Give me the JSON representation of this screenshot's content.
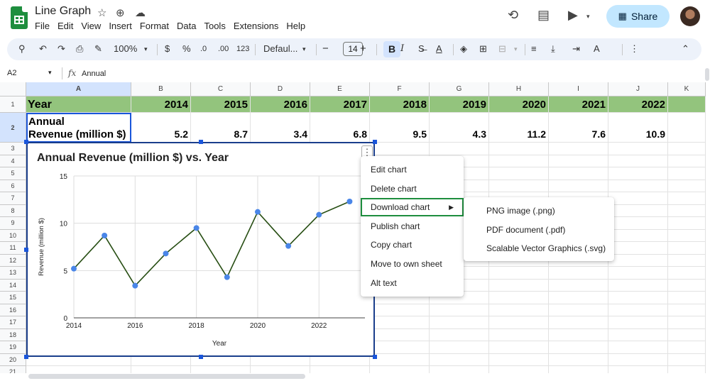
{
  "app": {
    "doc_title": "Line Graph",
    "share_label": "Share",
    "menus": [
      "File",
      "Edit",
      "View",
      "Insert",
      "Format",
      "Data",
      "Tools",
      "Extensions",
      "Help"
    ]
  },
  "toolbar": {
    "zoom": "100%",
    "currency": "$",
    "percent": "%",
    "dec_less": ".0",
    "dec_more": ".00",
    "format_123": "123",
    "font": "Defaul...",
    "font_size": "14",
    "minus": "−",
    "plus": "+",
    "bold": "B",
    "italic": "I"
  },
  "formula_bar": {
    "cell_ref": "A2",
    "fx": "fx",
    "content": "Annual"
  },
  "columns": [
    "A",
    "B",
    "C",
    "D",
    "E",
    "F",
    "G",
    "H",
    "I",
    "J",
    "K"
  ],
  "rows": [
    "1",
    "2",
    "3",
    "4",
    "5",
    "6",
    "7",
    "8",
    "9",
    "10",
    "11",
    "12",
    "13",
    "14",
    "15",
    "16",
    "17",
    "18",
    "19",
    "20",
    "21"
  ],
  "sheet": {
    "year_header": "Year",
    "revenue_header_line1": "Annual",
    "revenue_header_line2": "Revenue (million $)",
    "years": [
      "2014",
      "2015",
      "2016",
      "2017",
      "2018",
      "2019",
      "2020",
      "2021",
      "2022"
    ],
    "revenues": [
      "5.2",
      "8.7",
      "3.4",
      "6.8",
      "9.5",
      "4.3",
      "11.2",
      "7.6",
      "10.9"
    ]
  },
  "colors": {
    "header_fill": "#93c47d",
    "line": "#274e13",
    "point": "#4a86e8",
    "selection": "#1a3e8c"
  },
  "chart_data": {
    "type": "line",
    "title": "Annual Revenue (million $) vs. Year",
    "xlabel": "Year",
    "ylabel": "Revenue (million $)",
    "x": [
      2014,
      2015,
      2016,
      2017,
      2018,
      2019,
      2020,
      2021,
      2022,
      2023
    ],
    "series": [
      {
        "values": [
          5.2,
          8.7,
          3.4,
          6.8,
          9.5,
          4.3,
          11.2,
          7.6,
          10.9,
          12.3
        ]
      }
    ],
    "xticks": [
      "2014",
      "2016",
      "2018",
      "2020",
      "2022"
    ],
    "yticks": [
      "0",
      "5",
      "10",
      "15"
    ],
    "xlim": [
      2014,
      2023.5
    ],
    "ylim": [
      0,
      15
    ],
    "grid": true
  },
  "context_menu": {
    "items": [
      "Edit chart",
      "Delete chart",
      "Download chart",
      "Publish chart",
      "Copy chart",
      "Move to own sheet",
      "Alt text"
    ],
    "highlighted": "Download chart",
    "arrow": "▶"
  },
  "submenu": {
    "items": [
      "PNG image (.png)",
      "PDF document (.pdf)",
      "Scalable Vector Graphics (.svg)"
    ]
  }
}
